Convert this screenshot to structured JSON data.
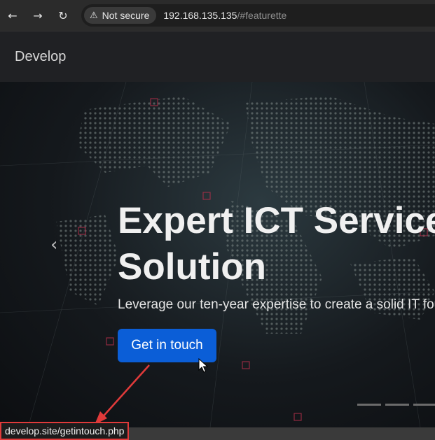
{
  "browser": {
    "back_icon": "←",
    "forward_icon": "→",
    "reload_icon": "↻",
    "security_label": "Not secure",
    "url_host": "192.168.135.135",
    "url_path": "/#featurette"
  },
  "site": {
    "brand": "Develop"
  },
  "hero": {
    "headline_line1": "Expert ICT Services",
    "headline_line2": "Solution",
    "lead": "Leverage our ten-year expertise to create a solid IT foundation",
    "cta_label": "Get in touch",
    "prev_icon": "‹"
  },
  "status_bar": {
    "link_url": "develop.site/getintouch.php"
  },
  "colors": {
    "accent": "#0b5ed7",
    "annotation": "#e03a3a"
  }
}
